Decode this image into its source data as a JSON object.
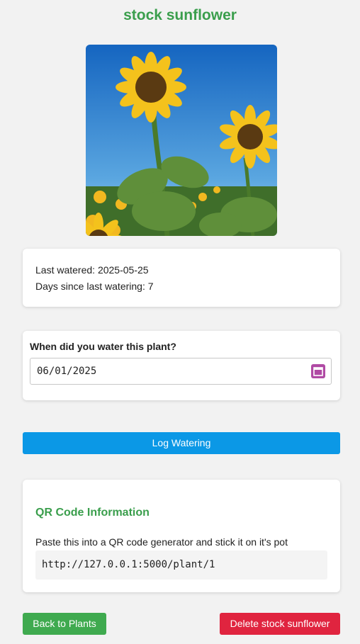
{
  "page": {
    "title": "stock sunflower"
  },
  "photo": {
    "subject": "sunflowers against blue sky"
  },
  "info": {
    "last_watered": "Last watered: 2025-05-25",
    "days_since": "Days since last watering: 7"
  },
  "form": {
    "label": "When did you water this plant?",
    "date_value": "06/01/2025",
    "calendar_icon": "calendar-icon",
    "submit_label": "Log Watering"
  },
  "qr": {
    "title": "QR Code Information",
    "description": "Paste this into a QR code generator and stick it on it's pot",
    "url": "http://127.0.0.1:5000/plant/1"
  },
  "actions": {
    "back_label": "Back to Plants",
    "delete_label": "Delete stock sunflower"
  },
  "colors": {
    "accent_green": "#3a9e4c",
    "primary_blue": "#0b98e6",
    "danger_red": "#e0243f",
    "calendar_purple": "#b04aa4"
  }
}
